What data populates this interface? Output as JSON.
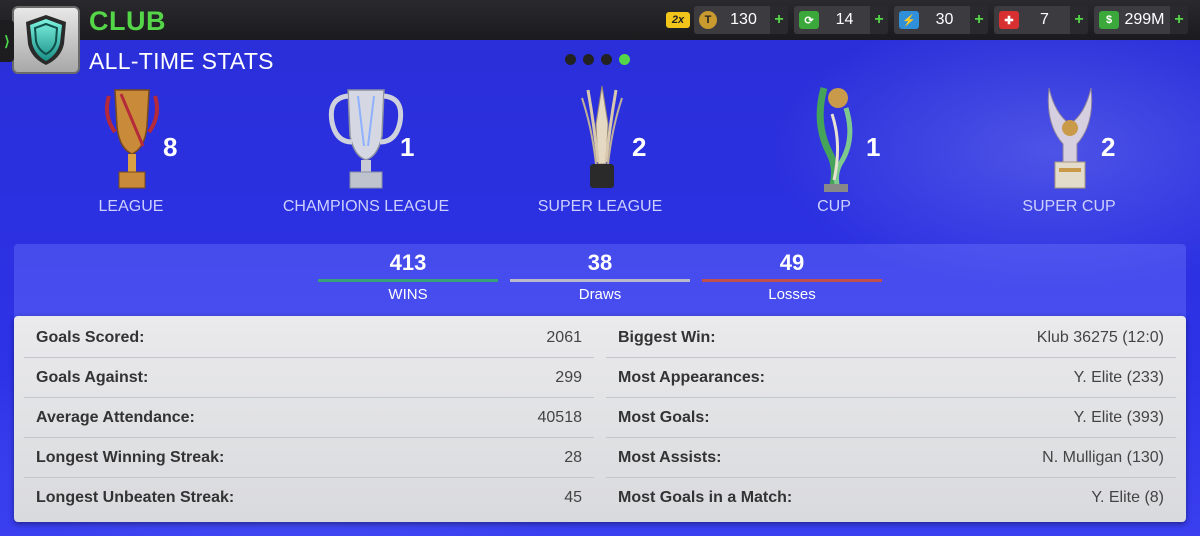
{
  "header": {
    "title": "CLUB",
    "subtitle": "ALL-TIME STATS"
  },
  "currencies": {
    "multiplier": "2x",
    "items": [
      {
        "name": "tokens",
        "value": "130",
        "icon": "token-icon"
      },
      {
        "name": "training",
        "value": "14",
        "icon": "training-icon"
      },
      {
        "name": "energy",
        "value": "30",
        "icon": "energy-icon"
      },
      {
        "name": "medical",
        "value": "7",
        "icon": "medical-icon"
      },
      {
        "name": "money",
        "value": "299M",
        "icon": "money-icon"
      }
    ]
  },
  "pagination": {
    "count": 4,
    "active": 4
  },
  "trophies": [
    {
      "label": "LEAGUE",
      "count": "8"
    },
    {
      "label": "CHAMPIONS LEAGUE",
      "count": "1"
    },
    {
      "label": "SUPER LEAGUE",
      "count": "2"
    },
    {
      "label": "CUP",
      "count": "1"
    },
    {
      "label": "SUPER CUP",
      "count": "2"
    }
  ],
  "results": [
    {
      "value": "413",
      "label": "WINS",
      "color": "#3aa07a"
    },
    {
      "value": "38",
      "label": "Draws",
      "color": "#b9b9c9"
    },
    {
      "value": "49",
      "label": "Losses",
      "color": "#c0504d"
    }
  ],
  "stats_left": [
    {
      "label": "Goals Scored:",
      "value": "2061"
    },
    {
      "label": "Goals Against:",
      "value": "299"
    },
    {
      "label": "Average Attendance:",
      "value": "40518"
    },
    {
      "label": "Longest Winning Streak:",
      "value": "28"
    },
    {
      "label": "Longest Unbeaten Streak:",
      "value": "45"
    }
  ],
  "stats_right": [
    {
      "label": "Biggest Win:",
      "value": "Klub 36275 (12:0)"
    },
    {
      "label": "Most Appearances:",
      "value": "Y. Elite (233)"
    },
    {
      "label": "Most Goals:",
      "value": "Y. Elite (393)"
    },
    {
      "label": "Most Assists:",
      "value": "N. Mulligan (130)"
    },
    {
      "label": "Most Goals in a Match:",
      "value": "Y. Elite (8)"
    }
  ],
  "colors": {
    "accent_green": "#55d648",
    "background_blue": "#2b30e0"
  }
}
